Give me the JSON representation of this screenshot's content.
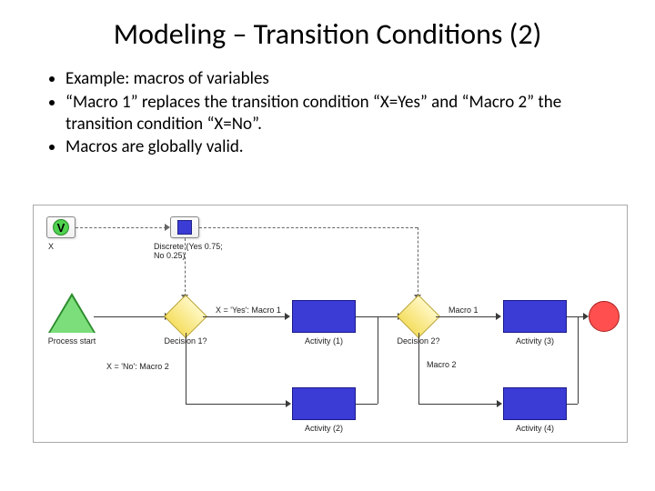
{
  "title": "Modeling – Transition Conditions (2)",
  "bullets": [
    "Example: macros of variables",
    "“Macro 1” replaces the transition condition “X=Yes” and “Macro 2” the transition condition “X=No”.",
    "Macros are globally valid."
  ],
  "diagram": {
    "vBadge": "V",
    "xLabel": "X",
    "discreteDist": "Discrete (Yes 0.75; No 0.25)",
    "processStart": "Process start",
    "decision1": "Decision 1?",
    "decision2": "Decision 2?",
    "macro1Edge": "X = 'Yes': Macro 1",
    "macro2Edge": "X = 'No': Macro 2",
    "macro1": "Macro 1",
    "macro2": "Macro 2",
    "activity1": "Activity (1)",
    "activity2": "Activity (2)",
    "activity3": "Activity (3)",
    "activity4": "Activity (4)"
  }
}
